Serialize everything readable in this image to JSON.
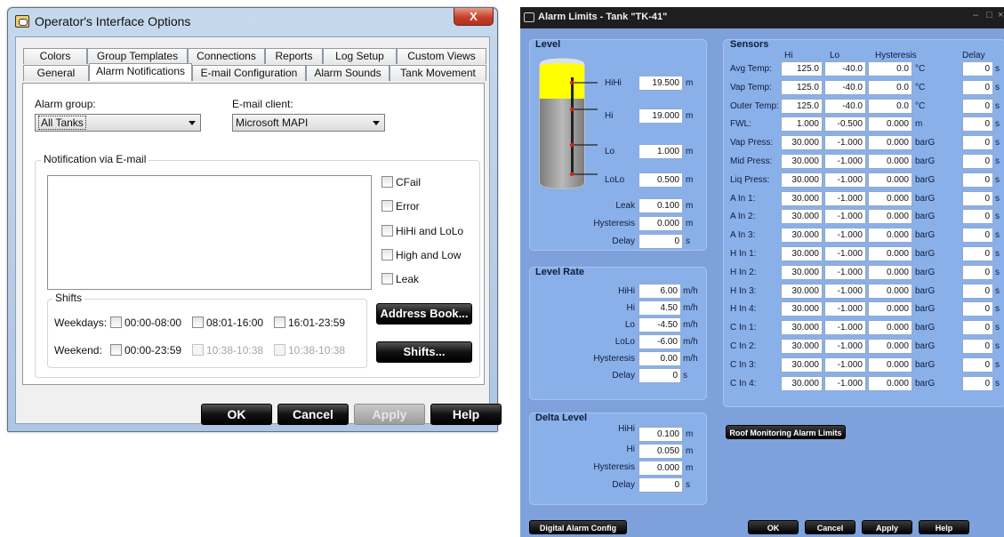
{
  "operator_dialog": {
    "title": "Operator's Interface Options",
    "close_label": "X",
    "tabs_row1": [
      "Colors",
      "Group Templates",
      "Connections",
      "Reports",
      "Log Setup",
      "Custom Views"
    ],
    "tabs_row2": [
      "General",
      "Alarm Notifications",
      "E-mail Configuration",
      "Alarm Sounds",
      "Tank Movement"
    ],
    "active_tab": "Alarm Notifications",
    "alarm_group_label": "Alarm group:",
    "alarm_group_value": "All Tanks",
    "email_client_label": "E-mail client:",
    "email_client_value": "Microsoft MAPI",
    "notification_group_title": "Notification via E-mail",
    "checkboxes": [
      "CFail",
      "Error",
      "HiHi and LoLo",
      "High and Low",
      "Leak"
    ],
    "shifts_title": "Shifts",
    "weekdays_label": "Weekdays:",
    "weekdays_shifts": [
      "00:00-08:00",
      "08:01-16:00",
      "16:01-23:59"
    ],
    "weekend_label": "Weekend:",
    "weekend_shifts": [
      "00:00-23:59",
      "10:38-10:38",
      "10:38-10:38"
    ],
    "address_book_button": "Address Book...",
    "shifts_button": "Shifts...",
    "buttons": {
      "ok": "OK",
      "cancel": "Cancel",
      "apply": "Apply",
      "help": "Help"
    }
  },
  "alarm_window": {
    "title": "Alarm Limits - Tank \"TK-41\"",
    "controls": {
      "minimize": "–",
      "maximize": "□",
      "close": "×"
    },
    "level": {
      "title": "Level",
      "rows": [
        {
          "label": "HiHi",
          "value": "19.500",
          "unit": "m"
        },
        {
          "label": "Hi",
          "value": "19.000",
          "unit": "m"
        },
        {
          "label": "Lo",
          "value": "1.000",
          "unit": "m"
        },
        {
          "label": "LoLo",
          "value": "0.500",
          "unit": "m"
        },
        {
          "label": "Leak",
          "value": "0.100",
          "unit": "m"
        },
        {
          "label": "Hysteresis",
          "value": "0.000",
          "unit": "m"
        },
        {
          "label": "Delay",
          "value": "0",
          "unit": "s"
        }
      ],
      "tank_colors": {
        "hihi_zone": "#ffff00",
        "product": "#a7a7a7",
        "marker": "#d42424"
      }
    },
    "level_rate": {
      "title": "Level Rate",
      "rows": [
        {
          "label": "HiHi",
          "value": "6.00",
          "unit": "m/h"
        },
        {
          "label": "Hi",
          "value": "4.50",
          "unit": "m/h"
        },
        {
          "label": "Lo",
          "value": "-4.50",
          "unit": "m/h"
        },
        {
          "label": "LoLo",
          "value": "-6.00",
          "unit": "m/h"
        },
        {
          "label": "Hysteresis",
          "value": "0.00",
          "unit": "m/h"
        },
        {
          "label": "Delay",
          "value": "0",
          "unit": "s"
        }
      ]
    },
    "delta_level": {
      "title": "Delta Level",
      "rows": [
        {
          "label": "HiHi",
          "value": "0.100",
          "unit": "m"
        },
        {
          "label": "Hi",
          "value": "0.050",
          "unit": "m"
        },
        {
          "label": "Hysteresis",
          "value": "0.000",
          "unit": "m"
        },
        {
          "label": "Delay",
          "value": "0",
          "unit": "s"
        }
      ]
    },
    "sensors": {
      "title": "Sensors",
      "headers": [
        "Hi",
        "Lo",
        "Hysteresis",
        "Delay"
      ],
      "rows": [
        {
          "label": "Avg Temp:",
          "hi": "125.0",
          "lo": "-40.0",
          "hyst": "0.0",
          "unit": "°C",
          "delay": "0",
          "delay_unit": "s"
        },
        {
          "label": "Vap Temp:",
          "hi": "125.0",
          "lo": "-40.0",
          "hyst": "0.0",
          "unit": "°C",
          "delay": "0",
          "delay_unit": "s"
        },
        {
          "label": "Outer Temp:",
          "hi": "125.0",
          "lo": "-40.0",
          "hyst": "0.0",
          "unit": "°C",
          "delay": "0",
          "delay_unit": "s"
        },
        {
          "label": "FWL:",
          "hi": "1.000",
          "lo": "-0.500",
          "hyst": "0.000",
          "unit": "m",
          "delay": "0",
          "delay_unit": "s"
        },
        {
          "label": "Vap Press:",
          "hi": "30.000",
          "lo": "-1.000",
          "hyst": "0.000",
          "unit": "barG",
          "delay": "0",
          "delay_unit": "s"
        },
        {
          "label": "Mid Press:",
          "hi": "30.000",
          "lo": "-1.000",
          "hyst": "0.000",
          "unit": "barG",
          "delay": "0",
          "delay_unit": "s"
        },
        {
          "label": "Liq Press:",
          "hi": "30.000",
          "lo": "-1.000",
          "hyst": "0.000",
          "unit": "barG",
          "delay": "0",
          "delay_unit": "s"
        },
        {
          "label": "A In 1:",
          "hi": "30.000",
          "lo": "-1.000",
          "hyst": "0.000",
          "unit": "barG",
          "delay": "0",
          "delay_unit": "s"
        },
        {
          "label": "A In 2:",
          "hi": "30.000",
          "lo": "-1.000",
          "hyst": "0.000",
          "unit": "barG",
          "delay": "0",
          "delay_unit": "s"
        },
        {
          "label": "A In 3:",
          "hi": "30.000",
          "lo": "-1.000",
          "hyst": "0.000",
          "unit": "barG",
          "delay": "0",
          "delay_unit": "s"
        },
        {
          "label": "H In 1:",
          "hi": "30.000",
          "lo": "-1.000",
          "hyst": "0.000",
          "unit": "barG",
          "delay": "0",
          "delay_unit": "s"
        },
        {
          "label": "H In 2:",
          "hi": "30.000",
          "lo": "-1.000",
          "hyst": "0.000",
          "unit": "barG",
          "delay": "0",
          "delay_unit": "s"
        },
        {
          "label": "H In 3:",
          "hi": "30.000",
          "lo": "-1.000",
          "hyst": "0.000",
          "unit": "barG",
          "delay": "0",
          "delay_unit": "s"
        },
        {
          "label": "H In 4:",
          "hi": "30.000",
          "lo": "-1.000",
          "hyst": "0.000",
          "unit": "barG",
          "delay": "0",
          "delay_unit": "s"
        },
        {
          "label": "C In 1:",
          "hi": "30.000",
          "lo": "-1.000",
          "hyst": "0.000",
          "unit": "barG",
          "delay": "0",
          "delay_unit": "s"
        },
        {
          "label": "C In 2:",
          "hi": "30.000",
          "lo": "-1.000",
          "hyst": "0.000",
          "unit": "barG",
          "delay": "0",
          "delay_unit": "s"
        },
        {
          "label": "C In 3:",
          "hi": "30.000",
          "lo": "-1.000",
          "hyst": "0.000",
          "unit": "barG",
          "delay": "0",
          "delay_unit": "s"
        },
        {
          "label": "C In 4:",
          "hi": "30.000",
          "lo": "-1.000",
          "hyst": "0.000",
          "unit": "barG",
          "delay": "0",
          "delay_unit": "s"
        }
      ]
    },
    "roof_button": "Roof Monitoring Alarm Limits",
    "digital_button": "Digital Alarm Config",
    "buttons": {
      "ok": "OK",
      "cancel": "Cancel",
      "apply": "Apply",
      "help": "Help"
    }
  }
}
